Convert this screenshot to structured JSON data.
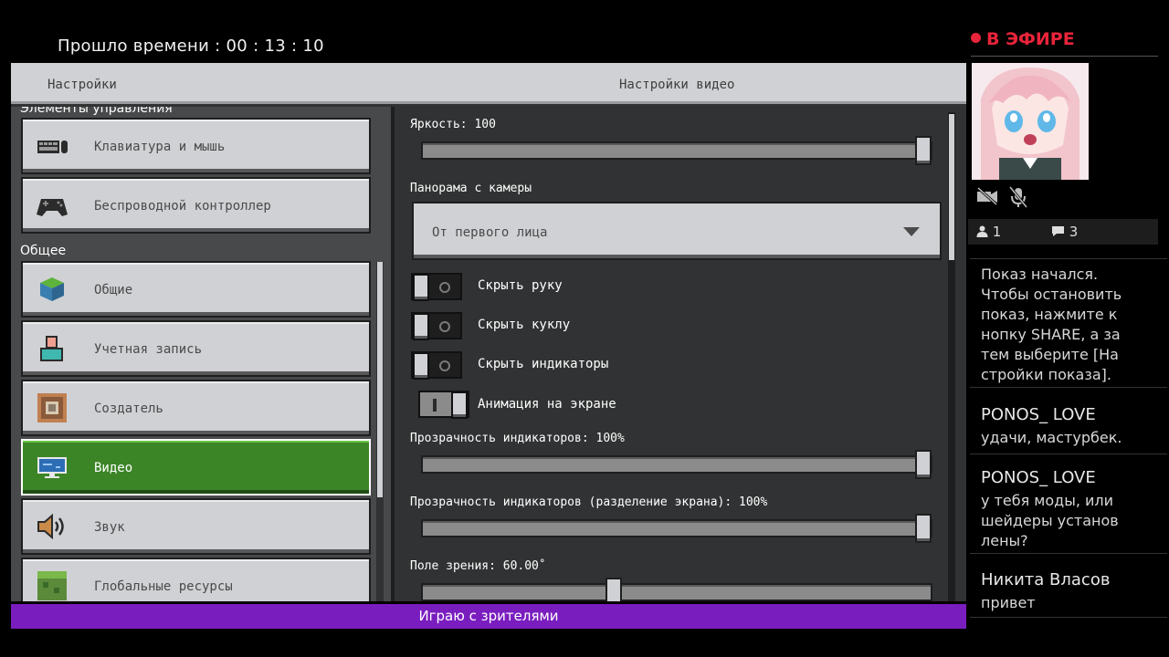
{
  "timer": {
    "label": "Прошло времени",
    "value": "00 : 13 : 10"
  },
  "game": {
    "header": {
      "left_title": "Настройки",
      "right_title": "Настройки видео"
    },
    "sidebar": {
      "section_controls": "Элементы управления",
      "section_general": "Общее",
      "items": [
        {
          "label": "Клавиатура и мышь",
          "icon": "keyboard-mouse-icon",
          "active": false
        },
        {
          "label": "Беспроводной контроллер",
          "icon": "gamepad-icon",
          "active": false
        },
        {
          "label": "Общие",
          "icon": "grass-cube-icon",
          "active": false
        },
        {
          "label": "Учетная запись",
          "icon": "account-icon",
          "active": false
        },
        {
          "label": "Создатель",
          "icon": "command-block-icon",
          "active": false
        },
        {
          "label": "Видео",
          "icon": "monitor-icon",
          "active": true
        },
        {
          "label": "Звук",
          "icon": "speaker-icon",
          "active": false
        },
        {
          "label": "Глобальные ресурсы",
          "icon": "resource-pack-icon",
          "active": false
        }
      ]
    },
    "video": {
      "brightness": {
        "label": "Яркость: 100",
        "value": 100,
        "max": 100
      },
      "camera": {
        "label": "Панорама с камеры",
        "value": "От первого лица"
      },
      "toggles": [
        {
          "label": "Скрыть руку",
          "on": false
        },
        {
          "label": "Скрыть куклу",
          "on": false
        },
        {
          "label": "Скрыть индикаторы",
          "on": false
        },
        {
          "label": "Анимация на экране",
          "on": true
        }
      ],
      "hud_opacity": {
        "label": "Прозрачность индикаторов: 100%",
        "value": 100,
        "max": 100
      },
      "split_opacity": {
        "label": "Прозрачность индикаторов (разделение экрана): 100%",
        "value": 100,
        "max": 100
      },
      "fov": {
        "label": "Поле зрения: 60.00˚",
        "value": 60,
        "min": 30,
        "max": 110
      }
    },
    "bottom_bar": "Играю с зрителями"
  },
  "stream": {
    "live_label": "В ЭФИРЕ",
    "viewers": "1",
    "comments": "3",
    "chat": [
      {
        "type": "system",
        "text": "Показ начался.\nЧтобы остановить\nпоказ, нажмите к\nнопку SHARE, а за\nтем выберите [На\nстройки показа]."
      },
      {
        "type": "user",
        "name": "PONOS_ LOVE",
        "text": "удачи, мастурбек."
      },
      {
        "type": "user",
        "name": "PONOS_ LOVE",
        "text": "у тебя моды, или\nшейдеры установ\nлены?"
      },
      {
        "type": "user",
        "name": "Никита Власов",
        "text": "привет"
      }
    ]
  },
  "colors": {
    "live_red": "#e8243a",
    "active_green": "#3c8527",
    "bottom_bar_purple": "#7a1dbf"
  }
}
